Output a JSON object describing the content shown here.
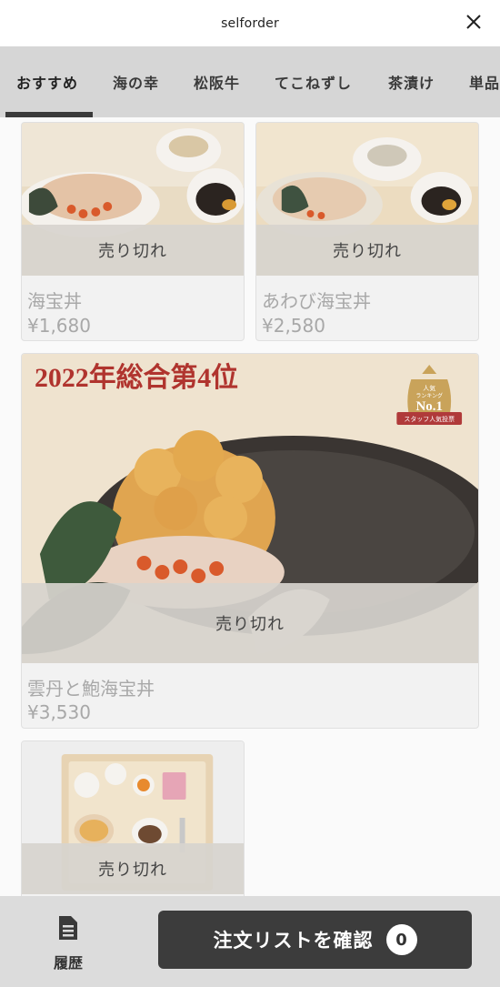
{
  "header": {
    "title": "selforder"
  },
  "tabs": [
    {
      "label": "おすすめ",
      "active": true
    },
    {
      "label": "海の幸"
    },
    {
      "label": "松阪牛"
    },
    {
      "label": "てこねずし"
    },
    {
      "label": "茶漬け"
    },
    {
      "label": "単品"
    }
  ],
  "items": [
    {
      "soldout_label": "売り切れ",
      "name": "海宝丼",
      "price": "¥1,680"
    },
    {
      "soldout_label": "売り切れ",
      "name": "あわび海宝丼",
      "price": "¥2,580"
    },
    {
      "soldout_label": "売り切れ",
      "name": "雲丹と鮑海宝丼",
      "price": "¥3,530",
      "banner": "2022年総合第4位",
      "badge": {
        "top": "人気",
        "mid": "ランキング",
        "main": "No.1",
        "ribbon": "スタッフ人気投票"
      }
    },
    {
      "soldout_label": "売り切れ"
    }
  ],
  "footer": {
    "history_label": "履歴",
    "order_label": "注文リストを確認",
    "order_count": "0"
  },
  "colors": {
    "soldout_overlay": "#d7d4ce",
    "order_button": "#3c3c3c",
    "tabbar": "#d6d6d6",
    "badge_gold": "#c9a35a",
    "badge_ribbon": "#b03a3a"
  },
  "icons": {
    "close": "close-icon",
    "history": "document-icon"
  }
}
